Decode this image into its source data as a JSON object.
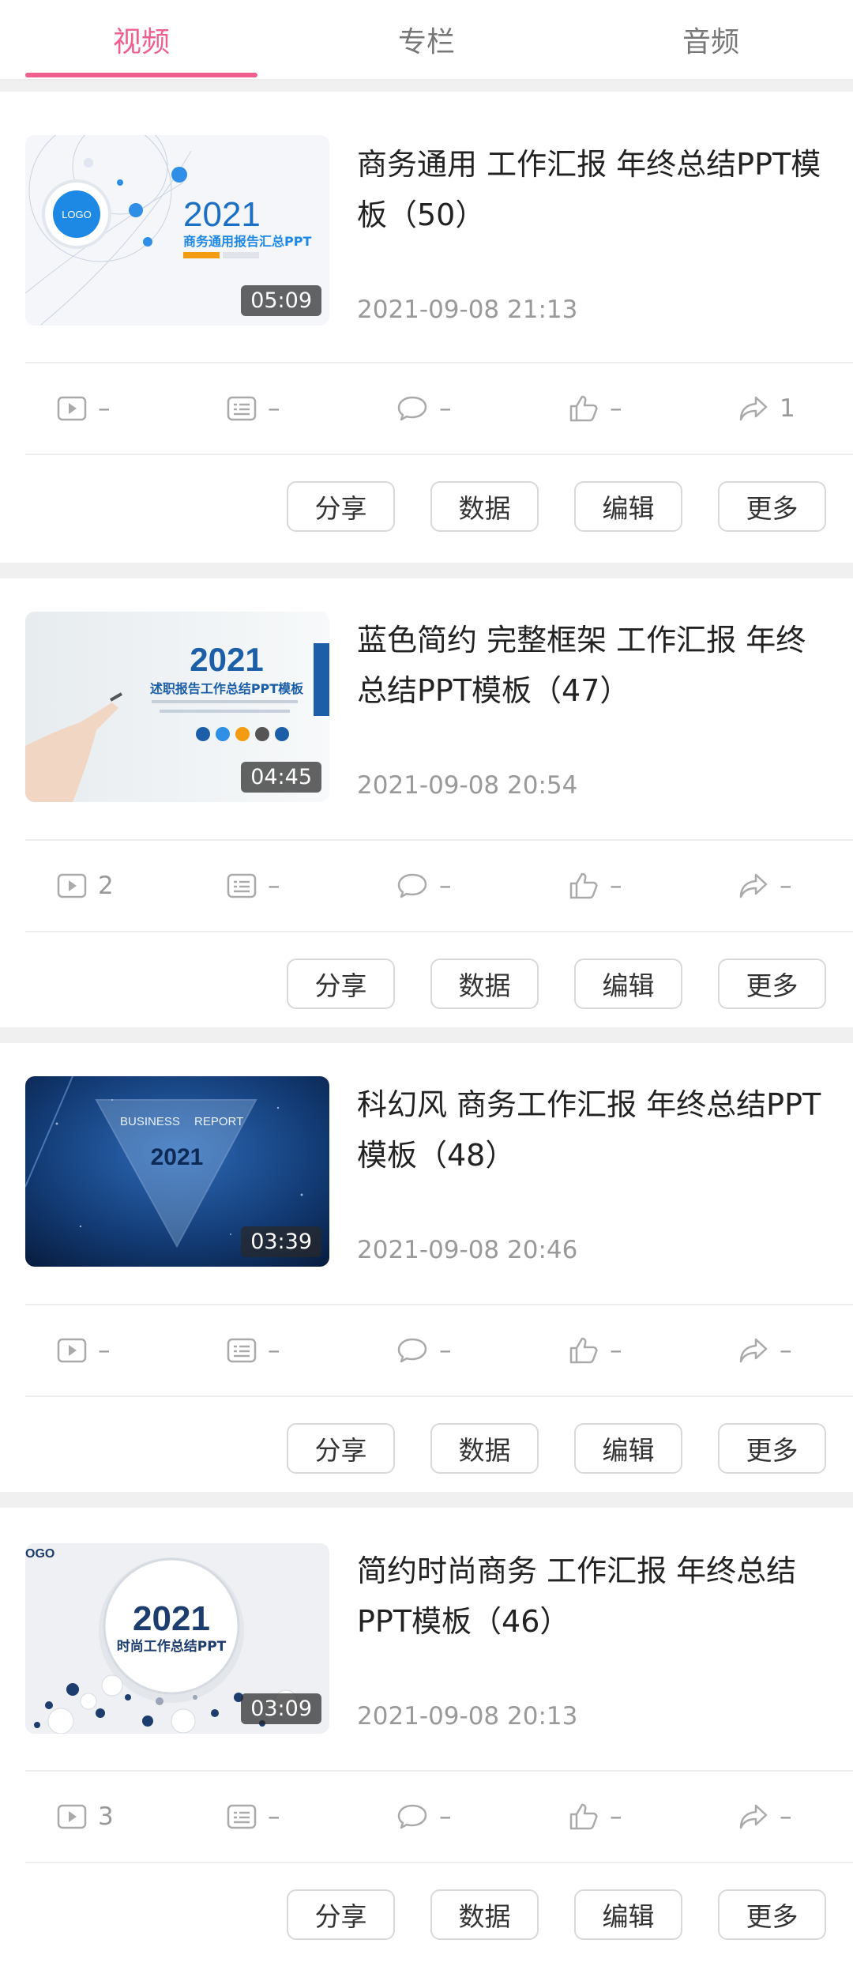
{
  "tabs": [
    {
      "label": "视频",
      "active": true
    },
    {
      "label": "专栏",
      "active": false
    },
    {
      "label": "音频",
      "active": false
    }
  ],
  "accent_color": "#ee5f8d",
  "actions": {
    "share": "分享",
    "data": "数据",
    "edit": "编辑",
    "more": "更多"
  },
  "videos": [
    {
      "title": "商务通用 工作汇报 年终总结PPT模板（50）",
      "date": "2021-09-08 21:13",
      "duration": "05:09",
      "thumb_text": {
        "year": "2021",
        "subtitle": "商务通用报告汇总PPT",
        "logo": "LOGO"
      },
      "stats": {
        "plays": "–",
        "danmaku": "–",
        "comments": "–",
        "likes": "–",
        "shares": "1"
      }
    },
    {
      "title": "蓝色简约 完整框架 工作汇报 年终总结PPT模板（47）",
      "date": "2021-09-08 20:54",
      "duration": "04:45",
      "thumb_text": {
        "year": "2021",
        "subtitle": "述职报告工作总结PPT模板"
      },
      "stats": {
        "plays": "2",
        "danmaku": "–",
        "comments": "–",
        "likes": "–",
        "shares": "–"
      }
    },
    {
      "title": "科幻风 商务工作汇报 年终总结PPT模板（48）",
      "date": "2021-09-08 20:46",
      "duration": "03:39",
      "thumb_text": {
        "year": "2021",
        "left": "BUSINESS",
        "right": "REPORT"
      },
      "stats": {
        "plays": "–",
        "danmaku": "–",
        "comments": "–",
        "likes": "–",
        "shares": "–"
      }
    },
    {
      "title": "简约时尚商务 工作汇报 年终总结PPT模板（46）",
      "date": "2021-09-08 20:13",
      "duration": "03:09",
      "thumb_text": {
        "year": "2021",
        "subtitle": "时尚工作总结PPT",
        "logo": "OGO"
      },
      "stats": {
        "plays": "3",
        "danmaku": "–",
        "comments": "–",
        "likes": "–",
        "shares": "–"
      }
    }
  ]
}
